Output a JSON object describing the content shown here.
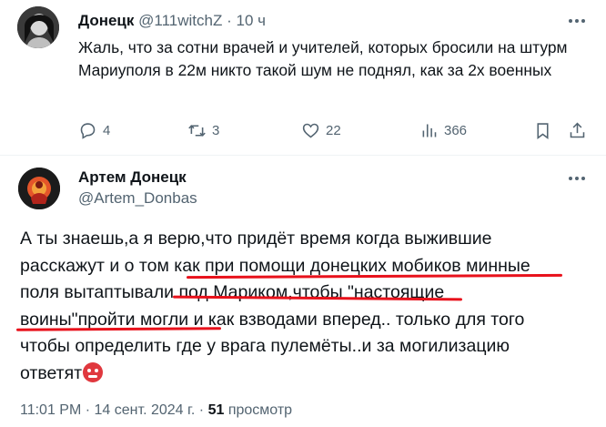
{
  "reply_tweet": {
    "author_name": "Донецк",
    "handle": "@111witchZ",
    "separator": "·",
    "time": "10 ч",
    "text": "Жаль, что за сотни врачей и учителей, которых бросили на штурм Мариуполя в 22м никто такой шум не поднял, как за 2х военных",
    "actions": {
      "replies": "4",
      "retweets": "3",
      "likes": "22",
      "views": "366"
    }
  },
  "main_tweet": {
    "author_name": "Артем Донецк",
    "handle": "@Artem_Donbas",
    "lines": [
      "А ты знаешь,а я верю,что придёт время когда выжившие",
      "расскажут и о том как при помощи донецких мобиков минные",
      "поля вытаптывали под Мариком,чтобы \"настоящие",
      "воины\"пройти могли и как взводами вперед.. только для того",
      "чтобы определить где у врага пулемёты..и за могилизацию",
      "ответят"
    ],
    "emoji": "angry-face",
    "time": "11:01 PM",
    "date": "14 сент. 2024 г.",
    "views_count": "51",
    "views_label": "просмотр"
  },
  "colors": {
    "text": "#0f1419",
    "secondary": "#536471",
    "underline": "#e8111b",
    "divider": "#eff3f4"
  }
}
